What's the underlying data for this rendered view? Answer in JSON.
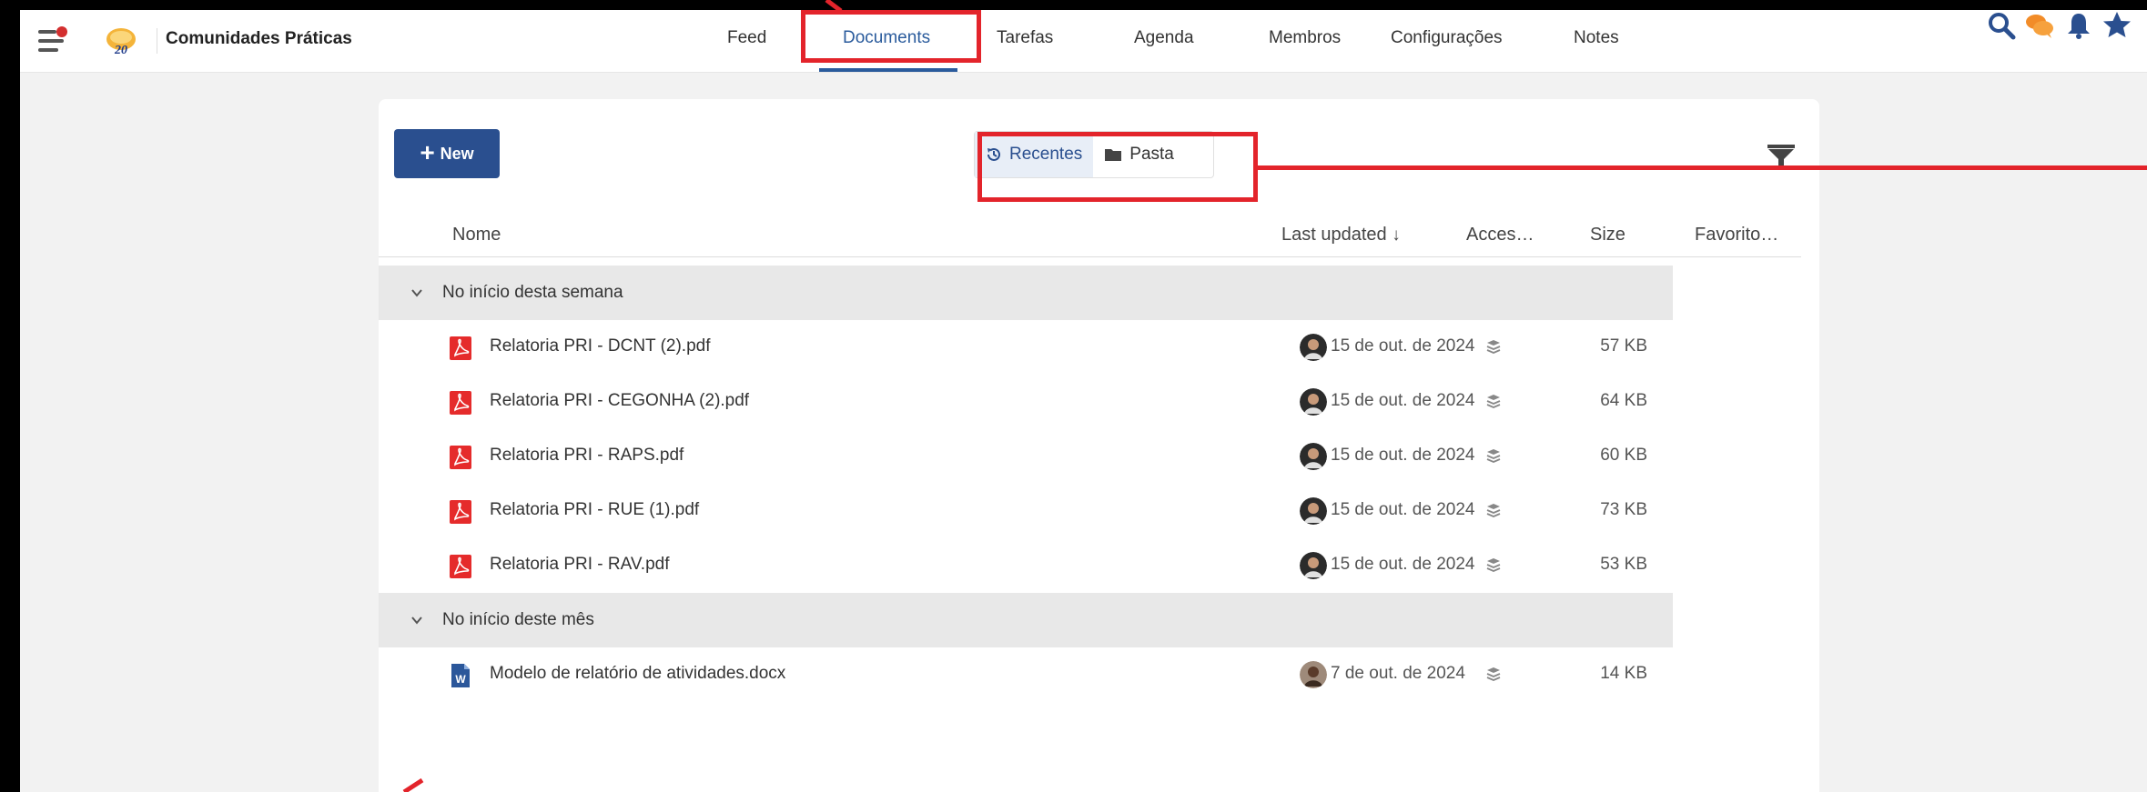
{
  "header": {
    "space_name": "Comunidades Práticas",
    "nav": [
      {
        "label": "Feed",
        "active": false
      },
      {
        "label": "Documents",
        "active": true
      },
      {
        "label": "Tarefas",
        "active": false
      },
      {
        "label": "Agenda",
        "active": false
      },
      {
        "label": "Membros",
        "active": false
      },
      {
        "label": "Configurações",
        "active": false
      },
      {
        "label": "Notes",
        "active": false
      }
    ],
    "icons": [
      "search-icon",
      "chat-icon",
      "bell-icon",
      "star-icon"
    ]
  },
  "toolbar": {
    "new_label": "New",
    "view_recent": "Recentes",
    "view_folder": "Pasta"
  },
  "columns": {
    "name": "Nome",
    "last_updated": "Last updated",
    "access": "Acces…",
    "size": "Size",
    "favorite": "Favorito…"
  },
  "groups": [
    {
      "label": "No início desta semana",
      "files": [
        {
          "name": "Relatoria PRI - DCNT (2).pdf",
          "type": "pdf",
          "date": "15 de out. de 2024",
          "size": "57 KB"
        },
        {
          "name": "Relatoria PRI - CEGONHA  (2).pdf",
          "type": "pdf",
          "date": "15 de out. de 2024",
          "size": "64 KB"
        },
        {
          "name": "Relatoria PRI - RAPS.pdf",
          "type": "pdf",
          "date": "15 de out. de 2024",
          "size": "60 KB"
        },
        {
          "name": "Relatoria PRI - RUE (1).pdf",
          "type": "pdf",
          "date": "15 de out. de 2024",
          "size": "73 KB"
        },
        {
          "name": "Relatoria PRI - RAV.pdf",
          "type": "pdf",
          "date": "15 de out. de 2024",
          "size": "53 KB"
        }
      ]
    },
    {
      "label": "No início deste mês",
      "files": [
        {
          "name": "Modelo de relatório de atividades.docx",
          "type": "docx",
          "date": "7 de out. de 2024",
          "size": "14 KB"
        }
      ]
    }
  ],
  "colors": {
    "accent": "#2a4f8f",
    "nav_active": "#2a5b9c",
    "highlight": "#e3242b",
    "pdf": "#e52b2b",
    "docx": "#2b579a"
  }
}
